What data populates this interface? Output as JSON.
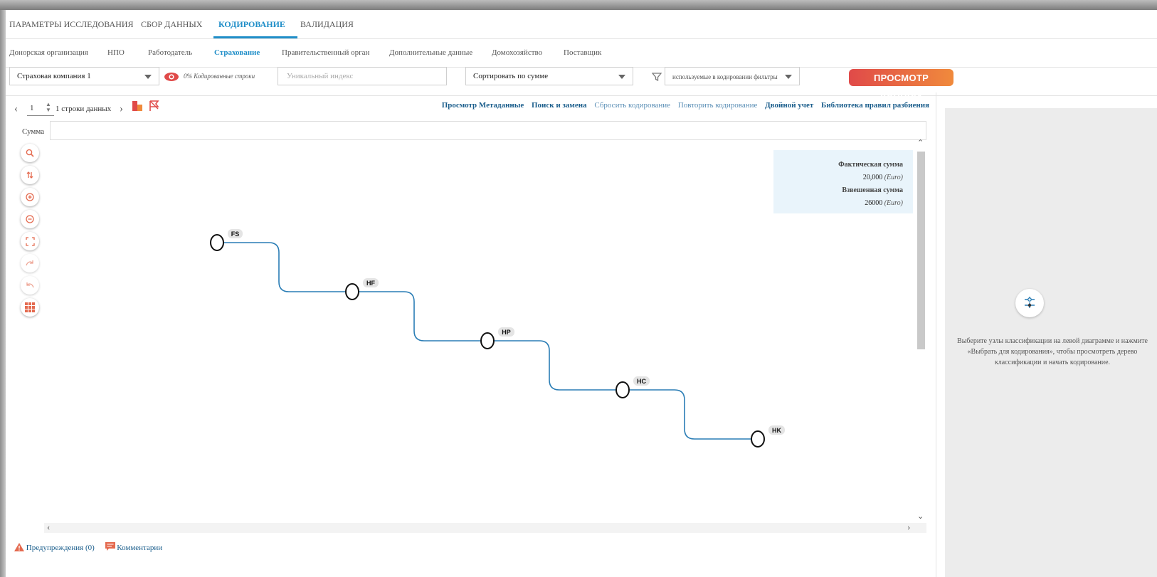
{
  "main_tabs": [
    "ПАРАМЕТРЫ ИССЛЕДОВАНИЯ",
    "СБОР ДАННЫХ",
    "КОДИРОВАНИЕ",
    "ВАЛИДАЦИЯ"
  ],
  "active_main_tab": "КОДИРОВАНИЕ",
  "sub_tabs": [
    "Донорская организация",
    "НПО",
    "Работодатель",
    "Страхование",
    "Правительственный орган",
    "Дополнительные данные",
    "Домохозяйство",
    "Поставщик"
  ],
  "active_sub_tab": "Страхование",
  "toolbar": {
    "company_select": "Страховая компания 1",
    "coded_rows": "0% Кодированные строки",
    "unique_index_placeholder": "Уникальный индекс",
    "sort_select": "Сортировать по сумме",
    "filters_select": "используемые в кодировании фильтры",
    "preview_button": "ПРОСМОТР ДАННЫХ"
  },
  "pager": {
    "page": "1",
    "rows_text": "1 строки данных"
  },
  "actions": [
    "Просмотр Метаданные",
    "Поиск и замена",
    "Сбросить кодирование",
    "Повторить кодирование",
    "Двойной учет",
    "Библиотека правил разбиения"
  ],
  "sum_label": "Сумма",
  "infobox": {
    "actual_label": "Фактическая сумма",
    "actual_value": "20,000",
    "currency": "(Euro)",
    "weighted_label": "Взвешенная сумма",
    "weighted_value": "26000"
  },
  "diagram": {
    "nodes": [
      "FS",
      "HF",
      "HP",
      "HC",
      "HK"
    ],
    "line_color": "#2a7db5"
  },
  "right_panel": {
    "hint": "Выберите узлы классификации на левой диаграмме и нажмите «Выбрать для кодирования», чтобы просмотреть дерево классификации и начать кодирование."
  },
  "footer": {
    "warnings": "Предупреждения (0)",
    "comments": "Комментарии"
  },
  "colors": {
    "accent": "#1f8ec8",
    "preview_start": "#e04a49",
    "preview_end": "#f08a3c",
    "tool_icon": "#e46a4f"
  }
}
